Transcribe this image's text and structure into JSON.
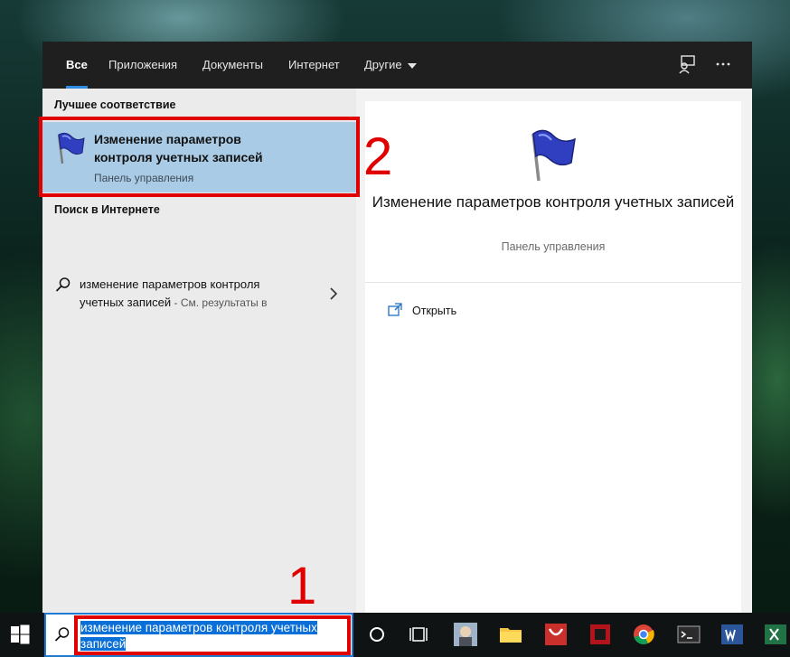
{
  "tabs": [
    {
      "label": "Все",
      "active": true
    },
    {
      "label": "Приложения",
      "active": false
    },
    {
      "label": "Документы",
      "active": false
    },
    {
      "label": "Интернет",
      "active": false
    },
    {
      "label": "Другие",
      "active": false
    }
  ],
  "left": {
    "best_match_title": "Лучшее соответствие",
    "best_match": {
      "title": "Изменение параметров контроля учетных записей",
      "subtitle": "Панель управления"
    },
    "web_title": "Поиск в Интернете",
    "web_result": {
      "query": "изменение параметров контроля учетных записей",
      "separator": " - ",
      "suffix": "См. результаты в"
    }
  },
  "right": {
    "title": "Изменение параметров контроля учетных записей",
    "subtitle": "Панель управления",
    "open_label": "Открыть"
  },
  "search": {
    "value": "изменение параметров контроля учетных записей"
  },
  "annotations": {
    "n1": "1",
    "n2": "2"
  },
  "icons": {
    "feedback": "feedback-icon",
    "more": "more-icon",
    "windows": "windows-start-icon",
    "search": "search-icon",
    "cortana": "cortana-icon",
    "taskview": "task-view-icon",
    "open": "open-icon"
  },
  "colors": {
    "accent": "#2f8de4",
    "selection": "#a9cbe6",
    "highlight": "#e00000",
    "topbar": "#1f1f1f"
  }
}
